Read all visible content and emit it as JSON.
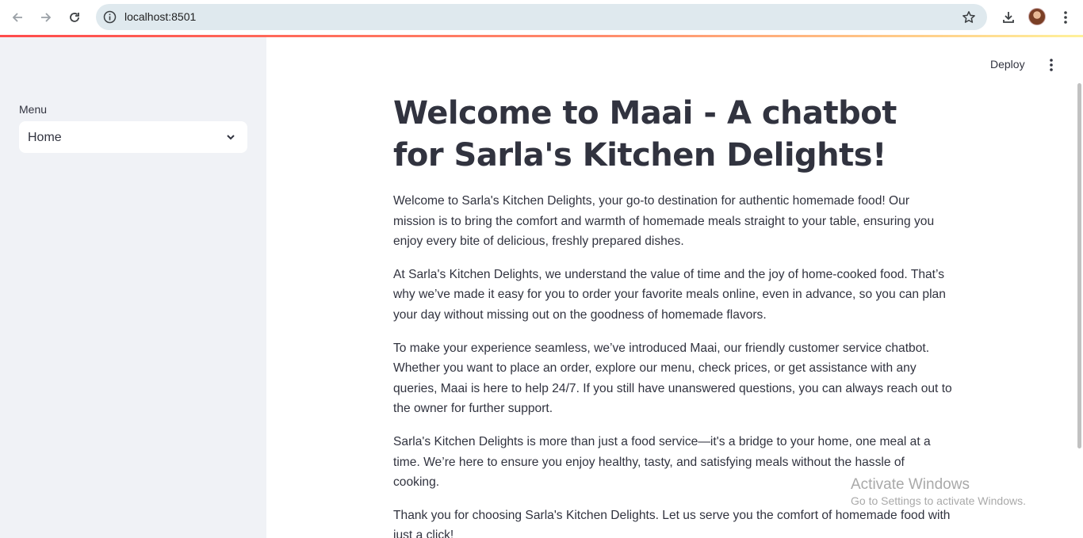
{
  "browser": {
    "url": "localhost:8501"
  },
  "sidebar": {
    "menu_label": "Menu",
    "menu_selected": "Home"
  },
  "header": {
    "deploy_label": "Deploy"
  },
  "main": {
    "title": "Welcome to Maai - A chatbot for Sarla's Kitchen Delights!",
    "paragraphs": [
      "Welcome to Sarla's Kitchen Delights, your go-to destination for authentic homemade food! Our mission is to bring the comfort and warmth of homemade meals straight to your table, ensuring you enjoy every bite of delicious, freshly prepared dishes.",
      "At Sarla's Kitchen Delights, we understand the value of time and the joy of home-cooked food. That’s why we’ve made it easy for you to order your favorite meals online, even in advance, so you can plan your day without missing out on the goodness of homemade flavors.",
      "To make your experience seamless, we’ve introduced Maai, our friendly customer service chatbot. Whether you want to place an order, explore our menu, check prices, or get assistance with any queries, Maai is here to help 24/7. If you still have unanswered questions, you can always reach out to the owner for further support.",
      "Sarla's Kitchen Delights is more than just a food service—it's a bridge to your home, one meal at a time. We’re here to ensure you enjoy healthy, tasty, and satisfying meals without the hassle of cooking.",
      "Thank you for choosing Sarla's Kitchen Delights. Let us serve you the comfort of homemade food with just a click!"
    ]
  },
  "watermark": {
    "title": "Activate Windows",
    "subtitle": "Go to Settings to activate Windows."
  },
  "colors": {
    "accent": "#ff4b4b",
    "sidebar_bg": "#f0f2f6",
    "text": "#31333f",
    "omnibox_bg": "#dfe9ee"
  }
}
